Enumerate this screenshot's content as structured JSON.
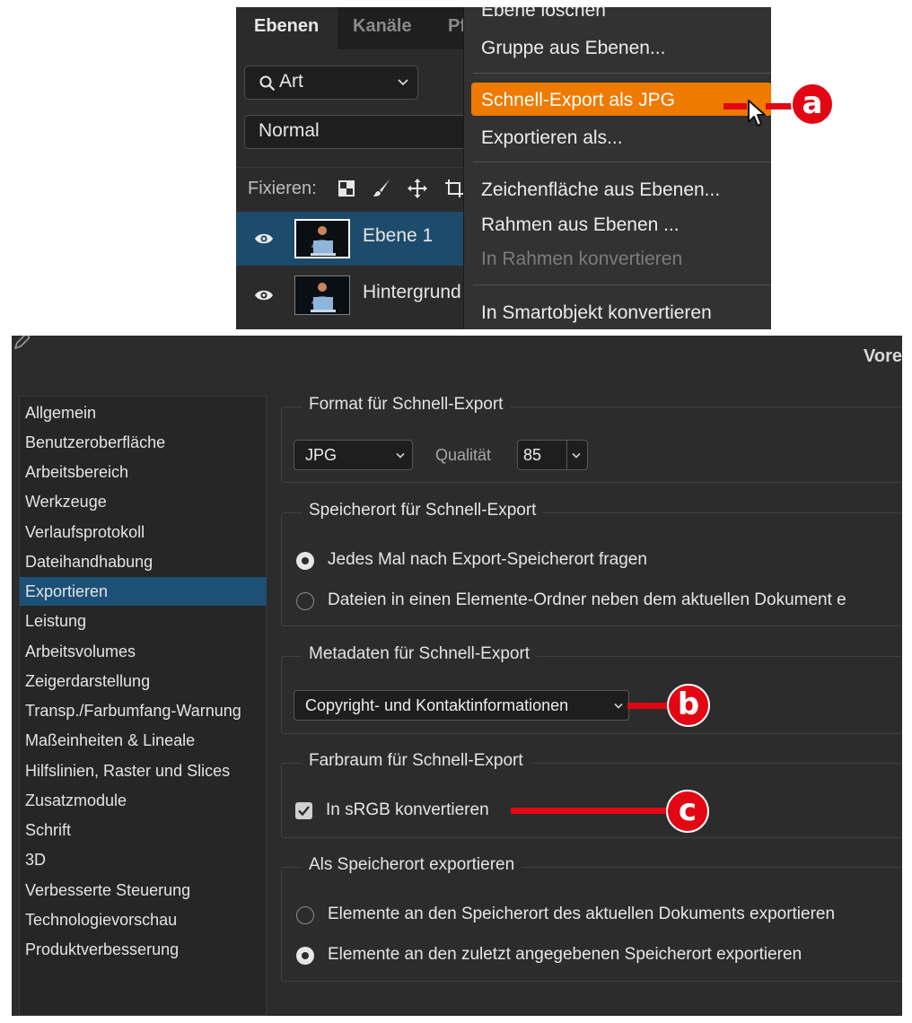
{
  "layers_panel": {
    "tabs": [
      "Ebenen",
      "Kanäle",
      "Pf"
    ],
    "filter_label": "Art",
    "blend_mode": "Normal",
    "lock_label": "Fixieren:",
    "layers": [
      {
        "name": "Ebene 1",
        "selected": true
      },
      {
        "name": "Hintergrund",
        "selected": false
      }
    ]
  },
  "context_menu": {
    "items": [
      {
        "label": "Ebene löschen",
        "state": "normal"
      },
      {
        "label": "Gruppe aus Ebenen...",
        "state": "normal"
      },
      {
        "label": "Schnell-Export als JPG",
        "state": "highlighted"
      },
      {
        "label": "Exportieren als...",
        "state": "normal"
      },
      {
        "label": "Zeichenfläche aus Ebenen...",
        "state": "normal"
      },
      {
        "label": "Rahmen aus Ebenen ...",
        "state": "normal"
      },
      {
        "label": "In Rahmen konvertieren",
        "state": "disabled"
      },
      {
        "label": "In Smartobjekt konvertieren",
        "state": "normal"
      }
    ]
  },
  "preferences": {
    "title": "Vore",
    "nav": [
      "Allgemein",
      "Benutzeroberfläche",
      "Arbeitsbereich",
      "Werkzeuge",
      "Verlaufsprotokoll",
      "Dateihandhabung",
      "Exportieren",
      "Leistung",
      "Arbeitsvolumes",
      "Zeigerdarstellung",
      "Transp./Farbumfang-Warnung",
      "Maßeinheiten & Lineale",
      "Hilfslinien, Raster und Slices",
      "Zusatzmodule",
      "Schrift",
      "3D",
      "Verbesserte Steuerung",
      "Technologievorschau",
      "Produktverbesserung"
    ],
    "selected_nav": "Exportieren",
    "format": {
      "title": "Format für Schnell-Export",
      "format_value": "JPG",
      "quality_label": "Qualität",
      "quality_value": "85"
    },
    "location": {
      "title": "Speicherort für Schnell-Export",
      "options": [
        {
          "label": "Jedes Mal nach Export-Speicherort fragen",
          "selected": true
        },
        {
          "label": "Dateien in einen Elemente-Ordner neben dem aktuellen Dokument e",
          "selected": false
        }
      ]
    },
    "metadata": {
      "title": "Metadaten für Schnell-Export",
      "value": "Copyright- und Kontaktinformationen"
    },
    "colorspace": {
      "title": "Farbraum für Schnell-Export",
      "checkbox_label": "In sRGB konvertieren",
      "checked": true
    },
    "save_location": {
      "title": "Als Speicherort exportieren",
      "options": [
        {
          "label": "Elemente an den Speicherort des aktuellen Dokuments exportieren",
          "selected": false
        },
        {
          "label": "Elemente an den zuletzt angegebenen Speicherort exportieren",
          "selected": true
        }
      ]
    }
  },
  "callouts": [
    "a",
    "b",
    "c"
  ],
  "colors": {
    "highlight": "#ee7a00",
    "selection": "#1c5077",
    "callout": "#e30613"
  }
}
